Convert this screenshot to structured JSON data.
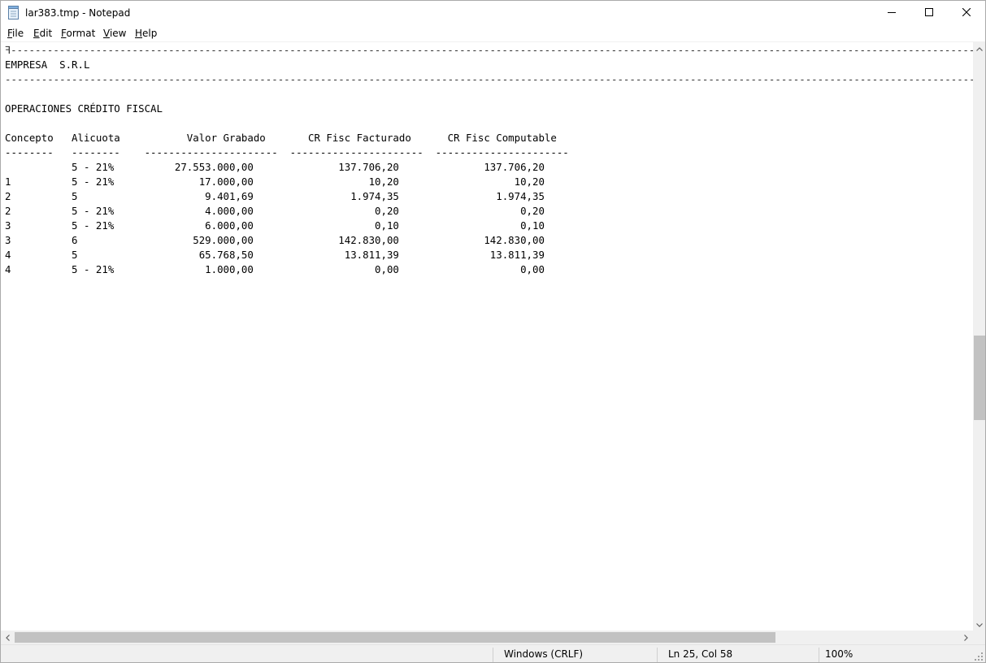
{
  "window": {
    "title": "lar383.tmp - Notepad",
    "icons": {
      "app": "notepad-icon",
      "minimize": "minimize-icon",
      "maximize": "maximize-icon",
      "close": "close-icon"
    }
  },
  "menu": {
    "file": "File",
    "edit": "Edit",
    "format": "Format",
    "view": "View",
    "help": "Help"
  },
  "document": {
    "lines": [
      "ꟻ-------------------------------------------------------------------------------------------------------------------------------------------------------------------------------------------------------",
      "EMPRESA  S.R.L",
      "--------------------------------------------------------------------------------------------------------------------------------------------------------------------------------------------------------",
      "",
      "OPERACIONES CRÉDITO FISCAL",
      "",
      "Concepto   Alicuota           Valor Grabado       CR Fisc Facturado      CR Fisc Computable",
      "--------   --------    ----------------------  ----------------------  ----------------------",
      "           5 - 21%          27.553.000,00              137.706,20              137.706,20",
      "1          5 - 21%              17.000,00                   10,20                   10,20",
      "2          5                     9.401,69                1.974,35                1.974,35",
      "2          5 - 21%               4.000,00                    0,20                    0,20",
      "3          5 - 21%               6.000,00                    0,10                    0,10",
      "3          6                   529.000,00              142.830,00              142.830,00",
      "4          5                    65.768,50               13.811,39               13.811,39",
      "4          5 - 21%               1.000,00                    0,00                    0,00"
    ]
  },
  "status": {
    "line_endings": "Windows (CRLF)",
    "position": "Ln 25, Col 58",
    "zoom": "100%"
  },
  "colors": {
    "scrollbar_track": "#f0f0f0",
    "scrollbar_thumb": "#c2c2c2",
    "statusbar_bg": "#f0f0f0"
  }
}
